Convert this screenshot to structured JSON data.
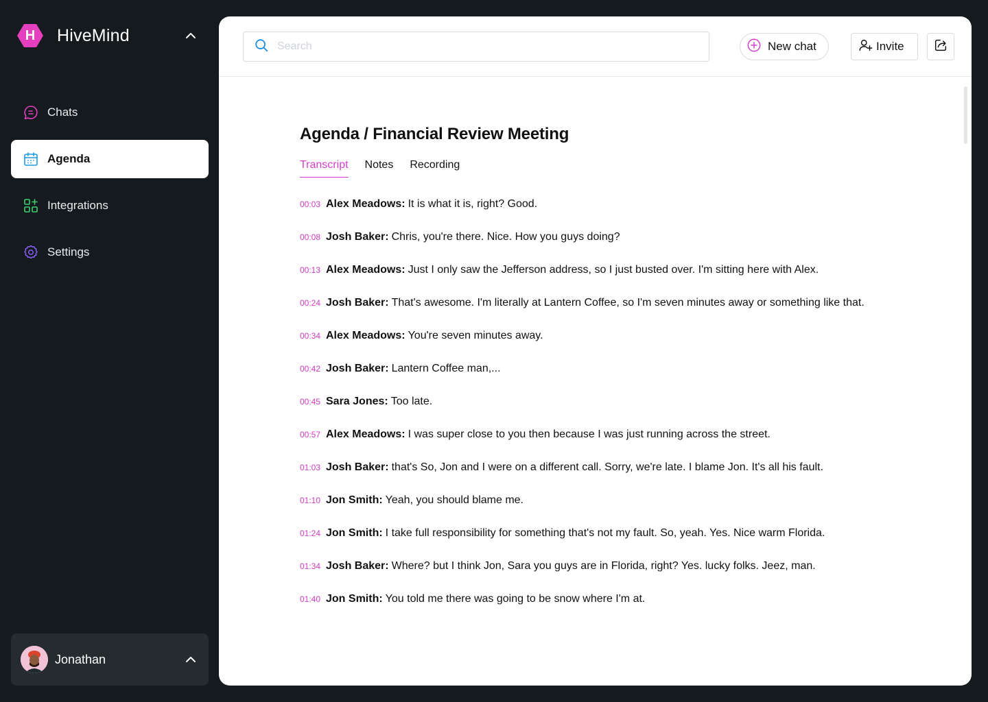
{
  "brand": {
    "logo_letter": "H",
    "name": "HiveMind",
    "accent": "#e43fbe"
  },
  "nav": [
    {
      "label": "Chats",
      "icon": "chat-bubble-icon",
      "active": false
    },
    {
      "label": "Agenda",
      "icon": "calendar-icon",
      "active": true
    },
    {
      "label": "Integrations",
      "icon": "grid-plus-icon",
      "active": false
    },
    {
      "label": "Settings",
      "icon": "gear-icon",
      "active": false
    }
  ],
  "user": {
    "name": "Jonathan"
  },
  "topbar": {
    "search_placeholder": "Search",
    "new_chat_label": "New chat",
    "invite_label": "Invite"
  },
  "page": {
    "title": "Agenda / Financial Review Meeting",
    "tabs": [
      "Transcript",
      "Notes",
      "Recording"
    ],
    "active_tab": "Transcript"
  },
  "transcript": [
    {
      "time": "00:03",
      "speaker": "Alex Meadows:",
      "text": "It is what it is, right? Good."
    },
    {
      "time": "00:08",
      "speaker": "Josh Baker:",
      "text": "Chris, you're there. Nice. How you guys doing?"
    },
    {
      "time": "00:13",
      "speaker": "Alex Meadows:",
      "text": "Just I only saw the Jefferson address, so I just busted over. I'm sitting here with Alex."
    },
    {
      "time": "00:24",
      "speaker": "Josh Baker:",
      "text": "That's awesome. I'm literally at Lantern Coffee, so I'm seven minutes away or something like that."
    },
    {
      "time": "00:34",
      "speaker": "Alex Meadows:",
      "text": "You're seven minutes away."
    },
    {
      "time": "00:42",
      "speaker": "Josh Baker:",
      "text": "Lantern Coffee man,..."
    },
    {
      "time": "00:45",
      "speaker": "Sara Jones:",
      "text": "Too late."
    },
    {
      "time": "00:57",
      "speaker": "Alex Meadows:",
      "text": "I was super close to you then because I was just running across the street."
    },
    {
      "time": "01:03",
      "speaker": "Josh Baker:",
      "text": "that's So, Jon and I were on a different call. Sorry, we're late. I blame Jon. It's all his fault."
    },
    {
      "time": "01:10",
      "speaker": "Jon Smith:",
      "text": "Yeah, you should blame me."
    },
    {
      "time": "01:24",
      "speaker": "Jon Smith:",
      "text": "I take full responsibility for something that's not my fault. So, yeah. Yes. Nice warm Florida."
    },
    {
      "time": "01:34",
      "speaker": "Josh Baker:",
      "text": "Where? but I think Jon, Sara you guys are in Florida, right? Yes. lucky folks. Jeez, man."
    },
    {
      "time": "01:40",
      "speaker": "Jon Smith:",
      "text": "You told me there was going to be snow where I'm at."
    }
  ],
  "colors": {
    "background": "#151a1e",
    "accent": "#d63ec9",
    "search_icon": "#1a8fe6"
  }
}
